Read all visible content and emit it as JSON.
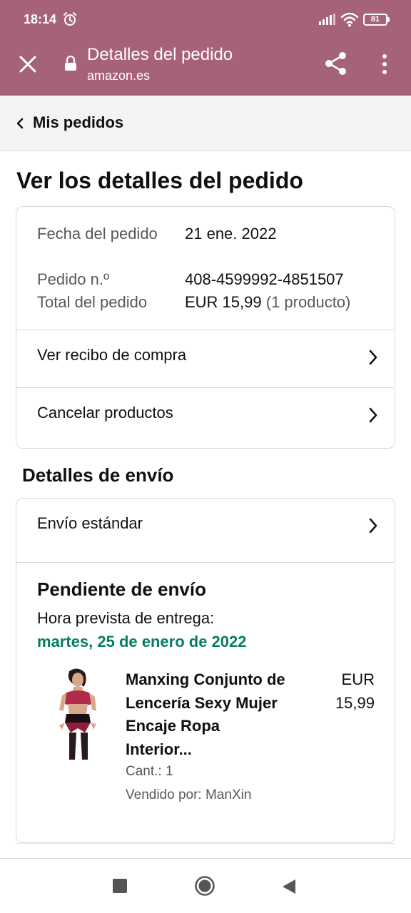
{
  "status_bar": {
    "time": "18:14",
    "battery": "81"
  },
  "browser": {
    "title": "Detalles del pedido",
    "url": "amazon.es"
  },
  "breadcrumb": {
    "label": "Mis pedidos"
  },
  "page_title": "Ver los detalles del pedido",
  "order": {
    "date_label": "Fecha del pedido",
    "date_value": "21 ene. 2022",
    "number_label": "Pedido n.º",
    "number_value": "408-4599992-4851507",
    "total_label": "Total del pedido",
    "total_value": "EUR 15,99",
    "total_count": "(1 producto)"
  },
  "links": {
    "receipt": "Ver recibo de compra",
    "cancel": "Cancelar productos"
  },
  "shipping": {
    "heading": "Detalles de envío",
    "method": "Envío estándar",
    "status": "Pendiente de envío",
    "eta_label": "Hora prevista de entrega:",
    "eta_date": "martes, 25 de enero de 2022"
  },
  "product": {
    "name": "Manxing Conjunto de Lencería Sexy Mujer Encaje Ropa Interior...",
    "price_currency": "EUR",
    "price_value": "15,99",
    "quantity": "Cant.: 1",
    "seller": "Vendido por: ManXin"
  },
  "icons": {
    "alarm": "alarm-icon",
    "close": "close-icon",
    "lock": "lock-icon",
    "share": "share-icon",
    "menu": "more-vert-icon",
    "chevron_left": "chevron-left-icon",
    "chevron_right": "chevron-right-icon"
  },
  "colors": {
    "browser_bar": "#a5627a",
    "eta_green": "#067d62",
    "text": "#0f1111",
    "muted": "#565959"
  }
}
